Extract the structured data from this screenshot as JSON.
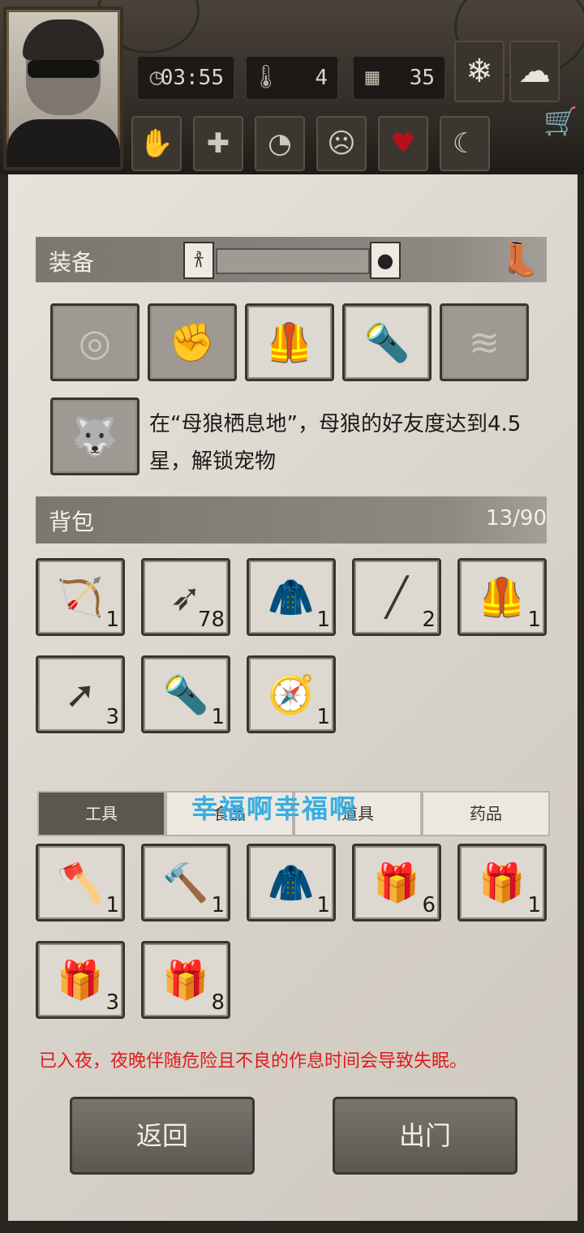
{
  "header": {
    "time": "03:55",
    "temperature": "4",
    "day": "35",
    "weather_icons": [
      "snowflake-icon",
      "cloud-icon"
    ],
    "status_icons": [
      "bandage-hand-icon",
      "health-cross-icon",
      "stomach-icon",
      "mind-icon",
      "heart-icon",
      "moon-sleep-icon"
    ],
    "cart_icon": "cart-icon"
  },
  "equipment": {
    "title": "装备",
    "slots": [
      {
        "icon": "target-icon",
        "empty": true
      },
      {
        "icon": "fist-icon",
        "empty": true
      },
      {
        "icon": "armor-vest-icon",
        "empty": false
      },
      {
        "icon": "flashlight-icon",
        "empty": false
      },
      {
        "icon": "wood-logs-icon",
        "empty": true
      }
    ],
    "pet_text": "在“母狼栖息地”，母狼的好友度达到4.5星，解锁宠物"
  },
  "backpack": {
    "title": "背包",
    "capacity": "13/90",
    "items": [
      {
        "icon": "bow-icon",
        "count": "1"
      },
      {
        "icon": "arrows-icon",
        "count": "78"
      },
      {
        "icon": "leather-vest-icon",
        "count": "1"
      },
      {
        "icon": "spear-icon",
        "count": "2"
      },
      {
        "icon": "armor-vest-icon",
        "count": "1"
      },
      {
        "icon": "arrow-icon",
        "count": "3"
      },
      {
        "icon": "flashlight-icon",
        "count": "1"
      },
      {
        "icon": "compass-icon",
        "count": "1"
      }
    ]
  },
  "tabs": {
    "items": [
      "工具",
      "食品",
      "道具",
      "药品"
    ],
    "selected": 0,
    "watermark": "幸福啊幸福啊"
  },
  "storage": {
    "items": [
      {
        "icon": "stone-axe-icon",
        "count": "1"
      },
      {
        "icon": "hammer-icon",
        "count": "1"
      },
      {
        "icon": "fur-coat-icon",
        "count": "1"
      },
      {
        "icon": "food-gift-box-icon",
        "count": "6"
      },
      {
        "icon": "medical-gift-box-icon",
        "count": "1"
      },
      {
        "icon": "tool-gift-box-icon",
        "count": "3"
      },
      {
        "icon": "material-gift-box-icon",
        "count": "8"
      }
    ]
  },
  "warning": "已入夜，夜晚伴随危险且不良的作息时间会导致失眠。",
  "buttons": {
    "back": "返回",
    "go_out": "出门"
  },
  "colors": {
    "warning": "#e01a1a",
    "watermark": "#3aaee0"
  }
}
